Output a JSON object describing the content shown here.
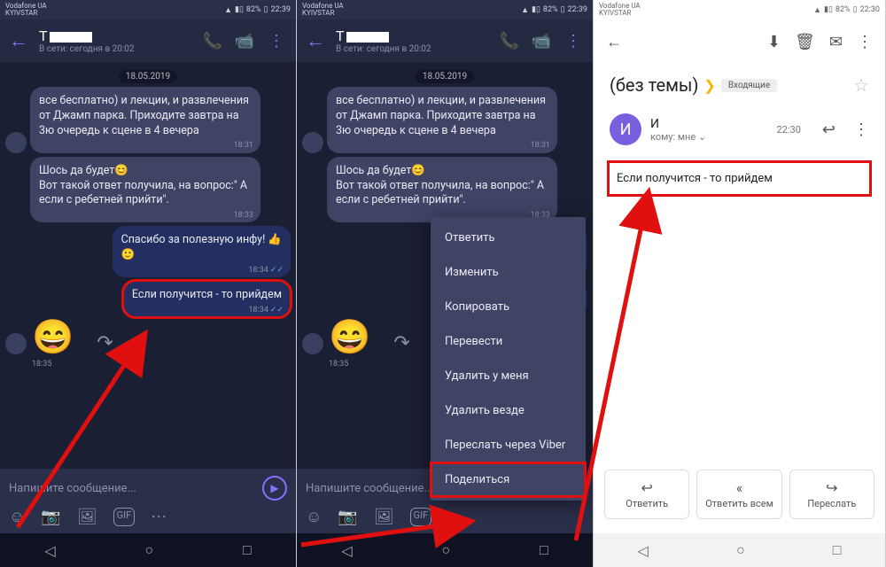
{
  "status": {
    "carrier1": "Vodafone UA",
    "carrier2": "KYIVSTAR",
    "battery": "82%",
    "time_left": "22:39",
    "time_right": "22:30"
  },
  "viber": {
    "contact_initial": "Т",
    "last_seen": "В сети: сегодня в 20:02",
    "date": "18.05.2019",
    "msg1": "все бесплатно) и лекции, и развлечения от Джамп парка. Приходите завтра на 3ю очередь к сцене в 4 вечера",
    "msg1_time": "18:31",
    "msg2_a": "Шось да будет",
    "msg2_b": "Вот такой ответ получила, на вопрос:\" А если с ребетней прийти\".",
    "msg2_time": "18:33",
    "msg3": "Спасибо за полезную инфу!",
    "msg3_time": "18:34",
    "msg4": "Если получится - то прийдем",
    "msg4_time": "18:34",
    "msg5_time": "18:35",
    "composer_ph": "Напишите сообщение..."
  },
  "menu": {
    "items": [
      "Ответить",
      "Изменить",
      "Копировать",
      "Перевести",
      "Удалить у меня",
      "Удалить везде",
      "Переслать через Viber",
      "Поделиться"
    ]
  },
  "gmail": {
    "subject": "(без темы)",
    "inbox_chip": "Входящие",
    "sender_initial": "И",
    "sender_name": "И",
    "to_line": "кому: мне",
    "time": "22:30",
    "body": "Если получится - то прийдем",
    "reply": "Ответить",
    "reply_all": "Ответить всем",
    "forward": "Переслать"
  }
}
